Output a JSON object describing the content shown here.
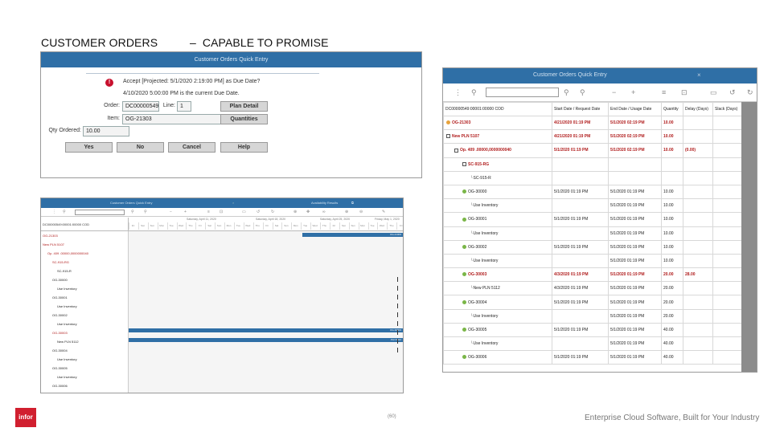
{
  "slide": {
    "title": "CUSTOMER ORDERS          –  CAPABLE TO PROMISE",
    "page_number": "(60)",
    "logo_text": "infor",
    "tagline": "Enterprise Cloud Software, Built for Your Industry"
  },
  "dialog": {
    "title": "Customer Orders Quick Entry",
    "message1": "Accept [Projected: 5/1/2020 2:19:00 PM] as Due Date?",
    "message2": "4/10/2020 5:00:00 PM is the current Due Date.",
    "order_label": "Order:",
    "order_value": "DC00000549",
    "line_label": "Line:",
    "line_value": "1",
    "item_label": "Item:",
    "item_value": "OG-21303",
    "qty_label": "Qty Ordered:",
    "qty_value": "10.00",
    "plan_detail": "Plan Detail",
    "quantities": "Quantities",
    "yes": "Yes",
    "no": "No",
    "cancel": "Cancel",
    "help": "Help"
  },
  "small_view": {
    "title": "Customer Orders Quick Entry",
    "results_title": "Availability Results",
    "order_code": "DC00000549:00001:00000 COD",
    "date_groups": [
      "Saturday, April 11, 2020",
      "Saturday, April 18, 2020",
      "Saturday, April 25, 2020",
      "Friday, May 1, 2020"
    ],
    "day_labels": [
      "Fri",
      "Sat",
      "Sun",
      "Mon",
      "Tue",
      "Wed",
      "Thu",
      "Fri",
      "Sat",
      "Sun",
      "Mon",
      "Tue",
      "Wed",
      "Thu",
      "Fri",
      "Sat",
      "Sun",
      "Mon",
      "Tue",
      "Wed",
      "Thu",
      "Fri",
      "Sat",
      "Sun",
      "Mon",
      "Tue",
      "Wed",
      "Thu",
      "Fri"
    ],
    "rows": [
      {
        "label": "OG-21303",
        "red": true
      },
      {
        "label": "New PLN 5107",
        "red": true
      },
      {
        "label": "Op.    409    .00000,0000000040",
        "red": true
      },
      {
        "label": "SC-915-RG",
        "red": true
      },
      {
        "label": "SC-915-R",
        "red": false
      },
      {
        "label": "OG-30000",
        "red": false
      },
      {
        "label": "Use Inventory",
        "red": false
      },
      {
        "label": "OG-30001",
        "red": false
      },
      {
        "label": "Use Inventory",
        "red": false
      },
      {
        "label": "OG-30002",
        "red": false
      },
      {
        "label": "Use Inventory",
        "red": false
      },
      {
        "label": "OG-30003",
        "red": true
      },
      {
        "label": "New PLN 5112",
        "red": false
      },
      {
        "label": "OG-30004",
        "red": false
      },
      {
        "label": "Use Inventory",
        "red": false
      },
      {
        "label": "OG-30005",
        "red": false
      },
      {
        "label": "Use Inventory",
        "red": false
      },
      {
        "label": "OG-30006",
        "red": false
      }
    ],
    "bar_labels": [
      "OG-21303",
      "OG-30003",
      "PLN 5112"
    ]
  },
  "large_view": {
    "title": "Customer Orders Quick Entry",
    "columns": [
      "DC00000549:00001:00000 COD",
      "Start Date / Request Date",
      "End Date / Usage Date",
      "Quantity",
      "Delay (Days)",
      "Slack (Days)"
    ],
    "rows": [
      {
        "name": "OG-21303",
        "start": "4/21/2020 01:19 PM",
        "end": "5/1/2020 02:19 PM",
        "qty": "10.00",
        "delay": "",
        "slack": "",
        "red": true,
        "indent": 0,
        "icon": "o"
      },
      {
        "name": "New PLN 5107",
        "start": "4/21/2020 01:19 PM",
        "end": "5/1/2020 02:19 PM",
        "qty": "10.00",
        "delay": "",
        "slack": "",
        "red": true,
        "indent": 0,
        "icon": "t"
      },
      {
        "name": "Op.     409       .00000,0000000040",
        "start": "5/1/2020 01:19 PM",
        "end": "5/1/2020 02:19 PM",
        "qty": "10.00",
        "delay": "(0.00)",
        "slack": "",
        "red": true,
        "indent": 1,
        "icon": "t"
      },
      {
        "name": "SC-915-RG",
        "start": "",
        "end": "",
        "qty": "",
        "delay": "",
        "slack": "",
        "red": true,
        "indent": 2,
        "icon": "t"
      },
      {
        "name": "SC-915-R",
        "start": "",
        "end": "",
        "qty": "",
        "delay": "",
        "slack": "",
        "red": false,
        "indent": 3,
        "icon": "l"
      },
      {
        "name": "OG-30000",
        "start": "5/1/2020 01:19 PM",
        "end": "5/1/2020 01:19 PM",
        "qty": "10.00",
        "delay": "",
        "slack": "",
        "red": false,
        "indent": 2,
        "icon": "g"
      },
      {
        "name": "Use Inventory",
        "start": "",
        "end": "5/1/2020 01:19 PM",
        "qty": "10.00",
        "delay": "",
        "slack": "",
        "red": false,
        "indent": 3,
        "icon": "l"
      },
      {
        "name": "OG-30001",
        "start": "5/1/2020 01:19 PM",
        "end": "5/1/2020 01:19 PM",
        "qty": "10.00",
        "delay": "",
        "slack": "",
        "red": false,
        "indent": 2,
        "icon": "g"
      },
      {
        "name": "Use Inventory",
        "start": "",
        "end": "5/1/2020 01:19 PM",
        "qty": "10.00",
        "delay": "",
        "slack": "",
        "red": false,
        "indent": 3,
        "icon": "l"
      },
      {
        "name": "OG-30002",
        "start": "5/1/2020 01:19 PM",
        "end": "5/1/2020 01:19 PM",
        "qty": "10.00",
        "delay": "",
        "slack": "",
        "red": false,
        "indent": 2,
        "icon": "g"
      },
      {
        "name": "Use Inventory",
        "start": "",
        "end": "5/1/2020 01:19 PM",
        "qty": "10.00",
        "delay": "",
        "slack": "",
        "red": false,
        "indent": 3,
        "icon": "l"
      },
      {
        "name": "OG-30003",
        "start": "4/3/2020 01:19 PM",
        "end": "5/1/2020 01:19 PM",
        "qty": "20.00",
        "delay": "28.00",
        "slack": "",
        "red": true,
        "indent": 2,
        "icon": "g"
      },
      {
        "name": "New PLN 5112",
        "start": "4/3/2020 01:19 PM",
        "end": "5/1/2020 01:19 PM",
        "qty": "20.00",
        "delay": "",
        "slack": "",
        "red": false,
        "indent": 3,
        "icon": "l"
      },
      {
        "name": "OG-30004",
        "start": "5/1/2020 01:19 PM",
        "end": "5/1/2020 01:19 PM",
        "qty": "20.00",
        "delay": "",
        "slack": "",
        "red": false,
        "indent": 2,
        "icon": "g"
      },
      {
        "name": "Use Inventory",
        "start": "",
        "end": "5/1/2020 01:19 PM",
        "qty": "20.00",
        "delay": "",
        "slack": "",
        "red": false,
        "indent": 3,
        "icon": "l"
      },
      {
        "name": "OG-30005",
        "start": "5/1/2020 01:19 PM",
        "end": "5/1/2020 01:19 PM",
        "qty": "40.00",
        "delay": "",
        "slack": "",
        "red": false,
        "indent": 2,
        "icon": "g"
      },
      {
        "name": "Use Inventory",
        "start": "",
        "end": "5/1/2020 01:19 PM",
        "qty": "40.00",
        "delay": "",
        "slack": "",
        "red": false,
        "indent": 3,
        "icon": "l"
      },
      {
        "name": "OG-30006",
        "start": "5/1/2020 01:19 PM",
        "end": "5/1/2020 01:19 PM",
        "qty": "40.00",
        "delay": "",
        "slack": "",
        "red": false,
        "indent": 2,
        "icon": "g"
      }
    ]
  }
}
